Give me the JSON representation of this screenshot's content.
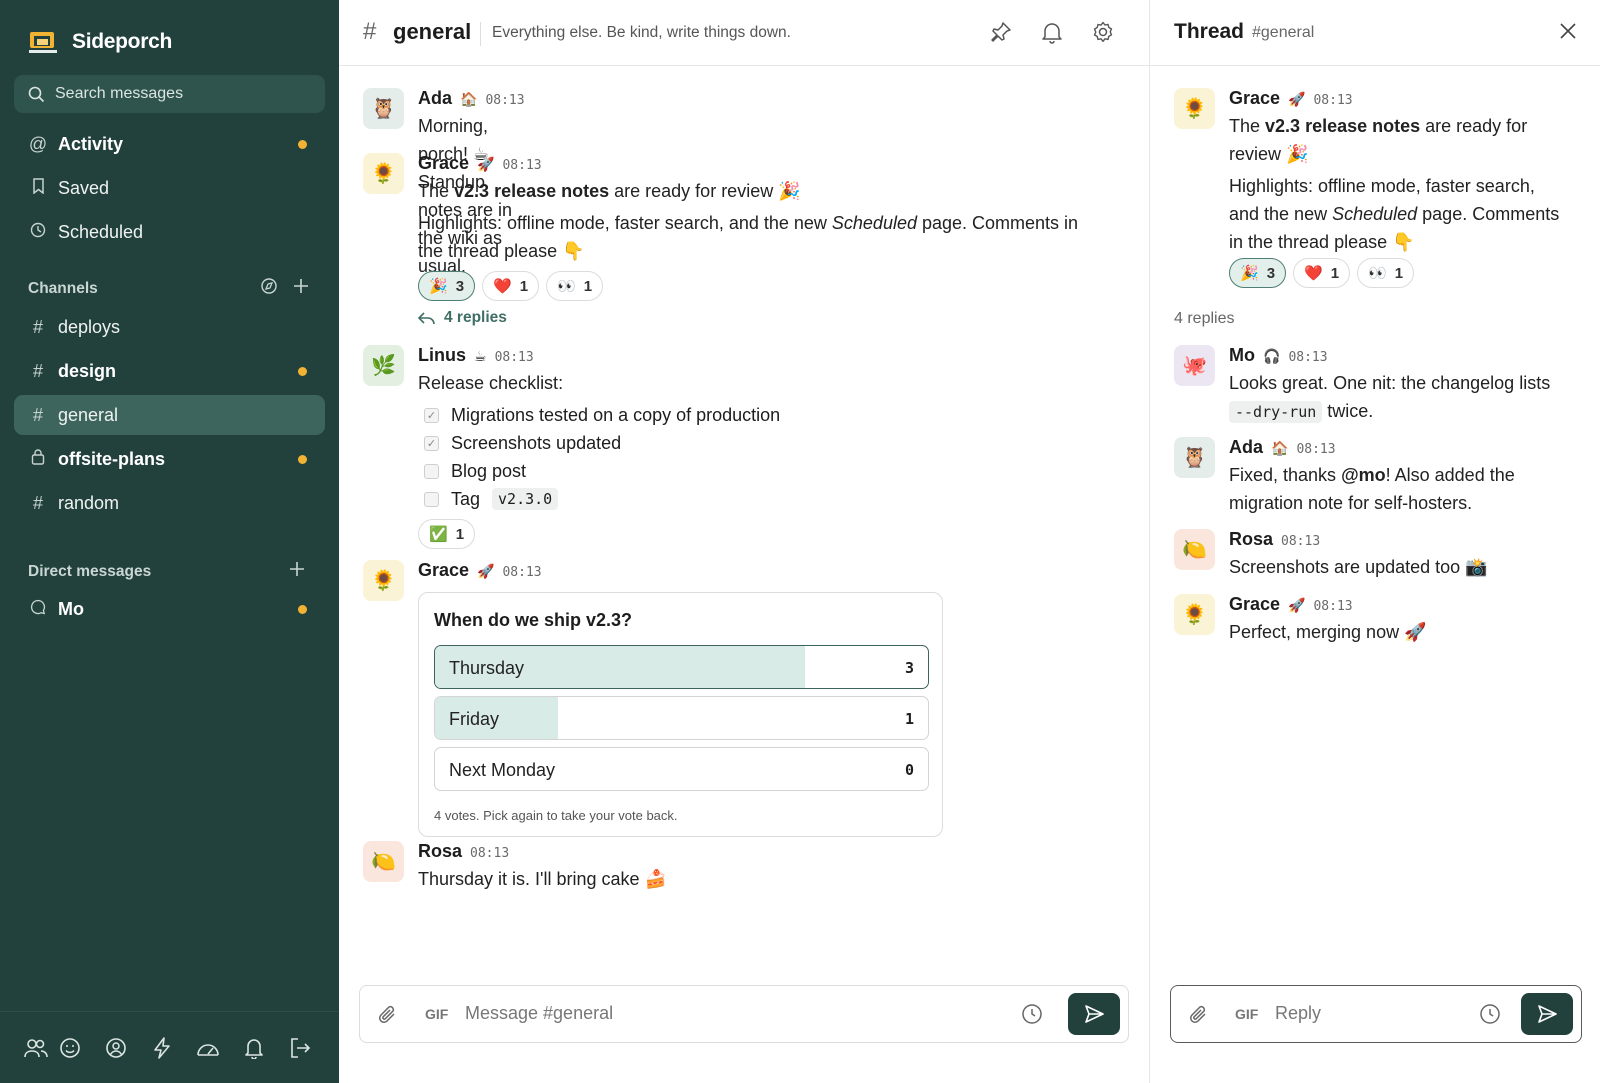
{
  "app": {
    "name": "Sideporch"
  },
  "sidebar": {
    "search_placeholder": "Search messages",
    "nav": [
      {
        "label": "Activity",
        "unread": true
      },
      {
        "label": "Saved",
        "unread": false
      },
      {
        "label": "Scheduled",
        "unread": false
      }
    ],
    "channels_heading": "Channels",
    "channels": [
      {
        "name": "deploys",
        "unread": false,
        "active": false
      },
      {
        "name": "design",
        "unread": true,
        "active": false
      },
      {
        "name": "general",
        "unread": false,
        "active": true
      },
      {
        "name": "offsite-plans",
        "unread": true,
        "active": false,
        "private": true
      },
      {
        "name": "random",
        "unread": false,
        "active": false
      }
    ],
    "dm_heading": "Direct messages",
    "dms": [
      {
        "name": "Mo",
        "unread": true
      }
    ]
  },
  "channel": {
    "hash": "#",
    "name": "general",
    "topic": "Everything else. Be kind, write things down."
  },
  "messages": {
    "ada": {
      "author": "Ada",
      "status": "🏠",
      "time": "08:13",
      "avatar": "🦉",
      "text": "Morning, porch! ☕  Standup notes are in the wiki as usual."
    },
    "grace1": {
      "author": "Grace",
      "status": "🚀",
      "time": "08:13",
      "avatar": "🌻",
      "line1_pre": "The ",
      "line1_bold": "v2.3 release notes",
      "line1_post": " are ready for review 🎉",
      "line2_pre": "Highlights: offline mode, faster search, and the new ",
      "line2_em": "Scheduled",
      "line2_post": " page. Comments in",
      "line3": "the thread please 👇",
      "reactions": [
        {
          "emoji": "🎉",
          "count": "3",
          "mine": true
        },
        {
          "emoji": "❤️",
          "count": "1"
        },
        {
          "emoji": "👀",
          "count": "1"
        }
      ],
      "replies_label": "4 replies"
    },
    "linus": {
      "author": "Linus",
      "status": "☕",
      "time": "08:13",
      "avatar": "🌿",
      "text": "Release checklist:",
      "checklist": [
        {
          "text": "Migrations tested on a copy of production",
          "checked": true
        },
        {
          "text": "Screenshots updated",
          "checked": true
        },
        {
          "text": "Blog post",
          "checked": false
        },
        {
          "text": "Tag",
          "code": "v2.3.0",
          "checked": false
        }
      ],
      "reactions": [
        {
          "emoji": "✅",
          "count": "1"
        }
      ]
    },
    "grace2": {
      "author": "Grace",
      "status": "🚀",
      "time": "08:13",
      "avatar": "🌻",
      "poll": {
        "question": "When do we ship v2.3?",
        "options": [
          {
            "label": "Thursday",
            "votes": 3,
            "count": "3",
            "fraction": 0.75,
            "selected": true
          },
          {
            "label": "Friday",
            "votes": 1,
            "count": "1",
            "fraction": 0.25
          },
          {
            "label": "Next Monday",
            "votes": 0,
            "count": "0",
            "fraction": 0
          }
        ],
        "footer": "4 votes. Pick again to take your vote back."
      }
    },
    "rosa": {
      "author": "Rosa",
      "status": "",
      "time": "08:13",
      "avatar": "🍋",
      "text": "Thursday it is. I'll bring cake 🍰"
    }
  },
  "composer": {
    "gif": "GIF",
    "placeholder": "Message #general"
  },
  "thread": {
    "title": "Thread",
    "channel": "#general",
    "root": {
      "author": "Grace",
      "status": "🚀",
      "time": "08:13",
      "avatar": "🌻",
      "l1_pre": "The ",
      "l1_bold": "v2.3 release notes",
      "l1_post": " are ready for",
      "l2": "review 🎉",
      "l3": "Highlights: offline mode, faster search,",
      "l4_pre": "and the new ",
      "l4_em": "Scheduled",
      "l4_post": " page. Comments",
      "l5": "in the thread please 👇",
      "reactions": [
        {
          "emoji": "🎉",
          "count": "3",
          "mine": true
        },
        {
          "emoji": "❤️",
          "count": "1"
        },
        {
          "emoji": "👀",
          "count": "1"
        }
      ]
    },
    "replies_count": "4 replies",
    "replies": {
      "mo": {
        "author": "Mo",
        "status": "🎧",
        "time": "08:13",
        "avatar": "🐙",
        "l1": "Looks great. One nit: the changelog lists",
        "l2_code": "--dry-run",
        "l2_post": " twice."
      },
      "ada": {
        "author": "Ada",
        "status": "🏠",
        "time": "08:13",
        "avatar": "🦉",
        "l1_pre": "Fixed, thanks ",
        "l1_bold": "@mo",
        "l1_post": "! Also added the",
        "l2": "migration note for self-hosters."
      },
      "rosa": {
        "author": "Rosa",
        "status": "",
        "time": "08:13",
        "avatar": "🍋",
        "l1": "Screenshots are updated too 📸"
      },
      "grace": {
        "author": "Grace",
        "status": "🚀",
        "time": "08:13",
        "avatar": "🌻",
        "l1": "Perfect, merging now 🚀"
      }
    },
    "composer": {
      "gif": "GIF",
      "placeholder": "Reply"
    }
  },
  "colors": {
    "sidebar": "#23413c",
    "accent": "#3d655d",
    "unread_dot": "#f2b233",
    "poll_fill": "#d9ebe6"
  }
}
